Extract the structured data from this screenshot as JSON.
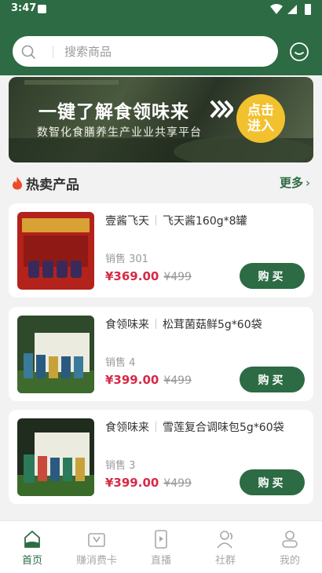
{
  "status_bar": {
    "time": "3:47"
  },
  "search": {
    "placeholder": "搜索商品"
  },
  "banner": {
    "headline": "一键了解食领味来",
    "subline": "数智化食膳养生产业业共享平台",
    "cta_line1": "点击",
    "cta_line2": "进入"
  },
  "section": {
    "title": "热卖产品",
    "more": "更多"
  },
  "products": [
    {
      "brand": "壹酱飞天",
      "name": "飞天酱160g*8罐",
      "sales": "销售 301",
      "price": "¥369.00",
      "original_price": "¥499",
      "buy": "购买"
    },
    {
      "brand": "食领味来",
      "name": "松茸菌菇鲜5g*60袋",
      "sales": "销售 4",
      "price": "¥399.00",
      "original_price": "¥499",
      "buy": "购买"
    },
    {
      "brand": "食领味来",
      "name": "雪莲复合调味包5g*60袋",
      "sales": "销售 3",
      "price": "¥399.00",
      "original_price": "¥499",
      "buy": "购买"
    }
  ],
  "tabs": [
    {
      "label": "首页",
      "icon": "home-icon",
      "active": true
    },
    {
      "label": "赚消费卡",
      "icon": "card-icon",
      "active": false
    },
    {
      "label": "直播",
      "icon": "live-icon",
      "active": false
    },
    {
      "label": "社群",
      "icon": "community-icon",
      "active": false
    },
    {
      "label": "我的",
      "icon": "profile-icon",
      "active": false
    }
  ],
  "colors": {
    "primary": "#2c6b43",
    "price": "#d62a46",
    "cta": "#f2c12e"
  }
}
